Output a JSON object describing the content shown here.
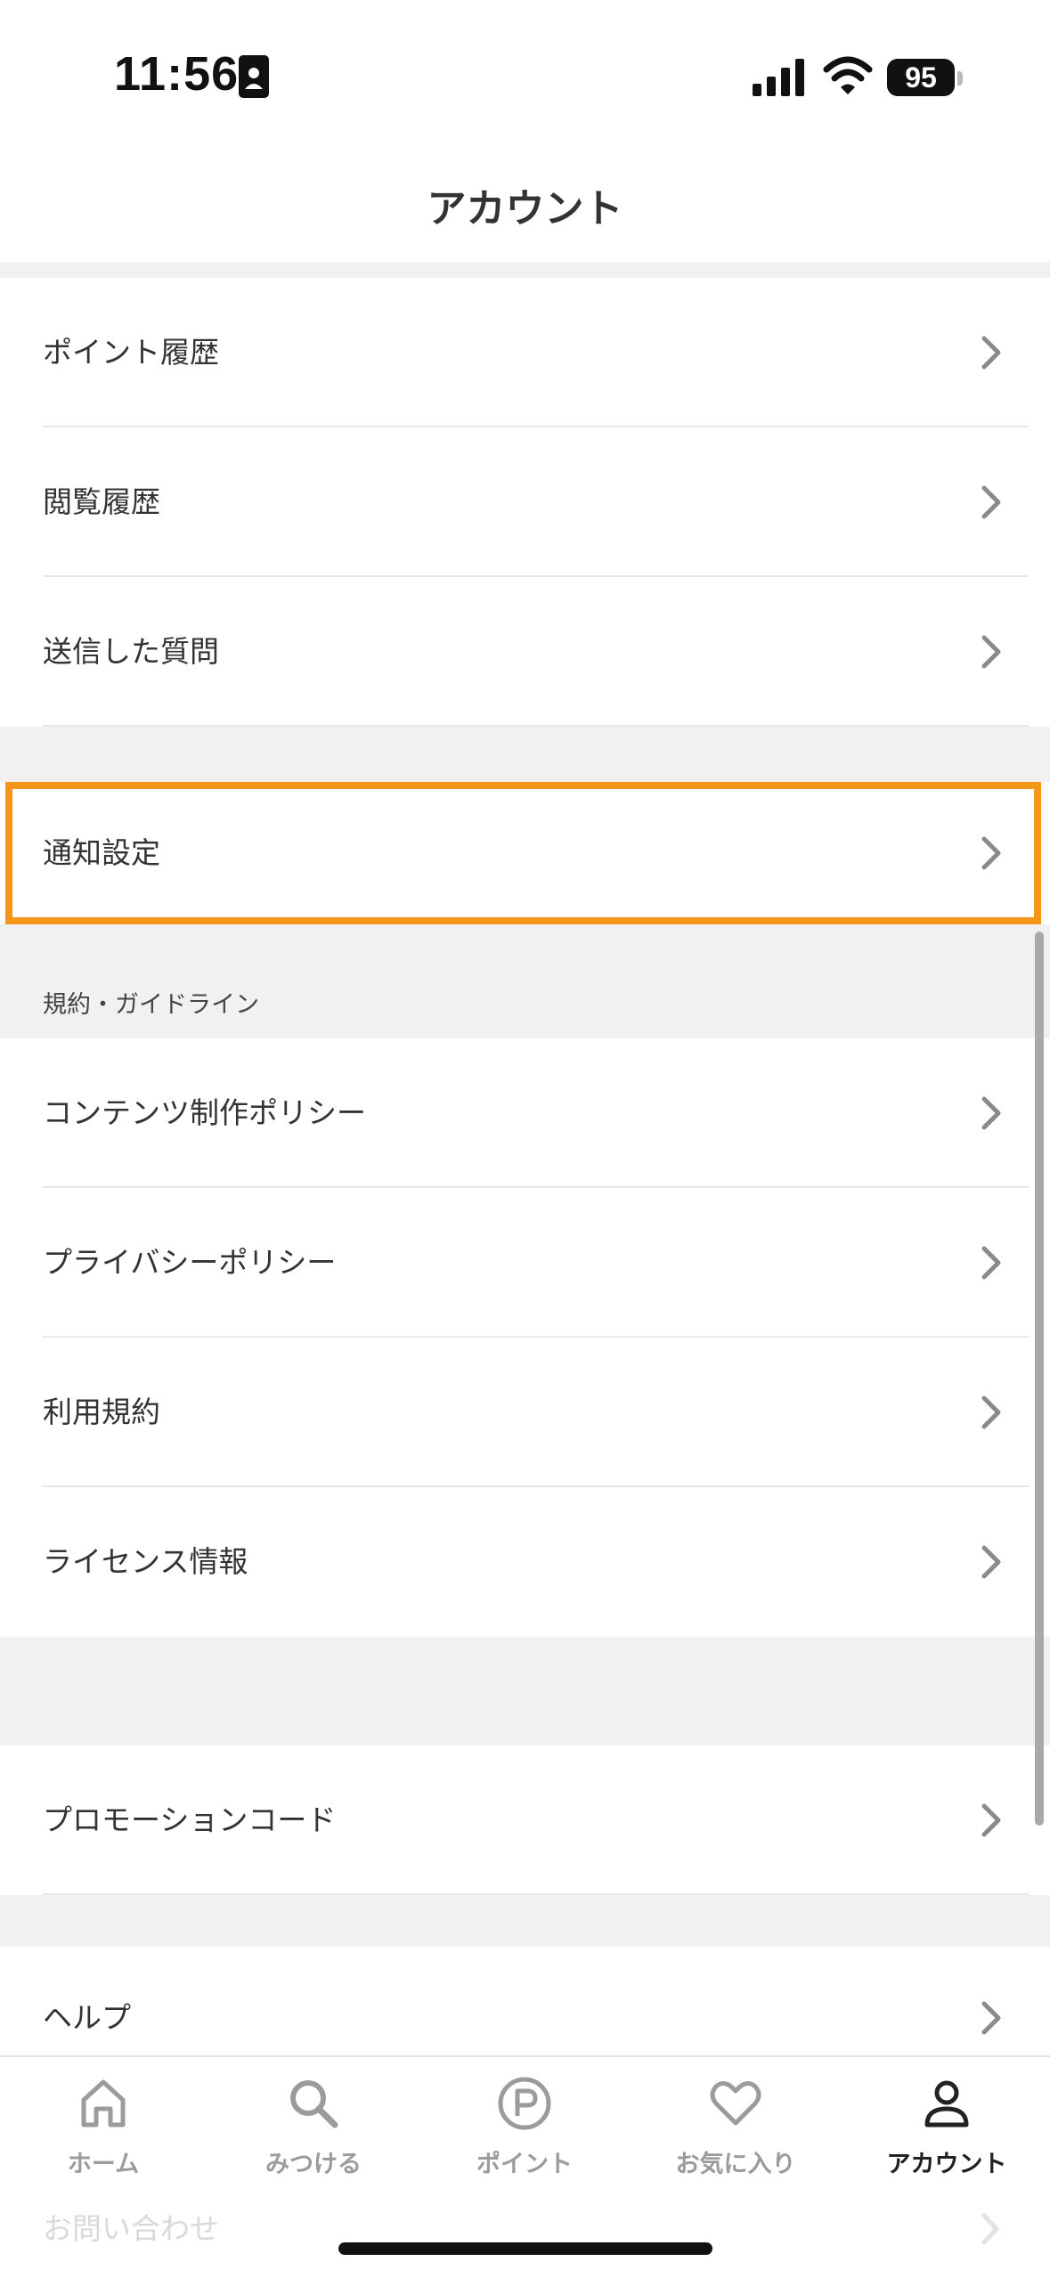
{
  "status_bar": {
    "time": "11:56",
    "battery": "95"
  },
  "header": {
    "title": "アカウント"
  },
  "group_history": [
    {
      "label": "ポイント履歴"
    },
    {
      "label": "閲覧履歴"
    },
    {
      "label": "送信した質問"
    }
  ],
  "group_notification": [
    {
      "label": "通知設定"
    }
  ],
  "terms_section": {
    "header": "規約・ガイドライン",
    "items": [
      {
        "label": "コンテンツ制作ポリシー"
      },
      {
        "label": "プライバシーポリシー"
      },
      {
        "label": "利用規約"
      },
      {
        "label": "ライセンス情報"
      }
    ]
  },
  "group_promo": [
    {
      "label": "プロモーションコード"
    }
  ],
  "group_support": [
    {
      "label": "ヘルプ"
    },
    {
      "label": "お問い合わせ"
    }
  ],
  "tab_bar": {
    "tabs": [
      {
        "label": "ホーム",
        "icon": "home-icon",
        "active": false
      },
      {
        "label": "みつける",
        "icon": "search-icon",
        "active": false
      },
      {
        "label": "ポイント",
        "icon": "points-icon",
        "active": false
      },
      {
        "label": "お気に入り",
        "icon": "heart-icon",
        "active": false
      },
      {
        "label": "アカウント",
        "icon": "person-icon",
        "active": true
      }
    ]
  },
  "colors": {
    "highlight": "#f3961a",
    "background": "#f1f1f1",
    "active_tab": "#222222",
    "inactive_tab": "#9b9b9b"
  }
}
